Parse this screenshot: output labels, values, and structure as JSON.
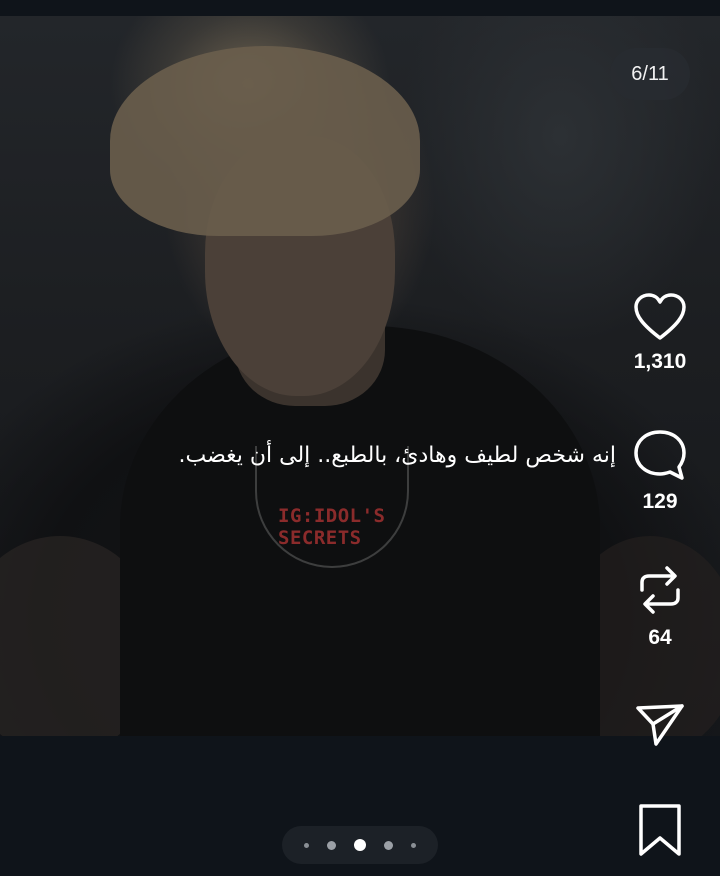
{
  "post": {
    "caption": "إنه شخص لطيف وهادئ، بالطبع.. إلى أن يغضب.",
    "watermark": "IG:IDOL'S SECRETS",
    "slide_counter": "6/11"
  },
  "actions": {
    "like_count": "1,310",
    "comment_count": "129",
    "repost_count": "64"
  },
  "carousel": {
    "total_dots_visible": 5,
    "active_index": 2
  },
  "colors": {
    "background": "#0f141a",
    "watermark": "#8b2b2b",
    "icon": "#ffffff"
  },
  "icons": [
    "heart-icon",
    "comment-icon",
    "repost-icon",
    "share-icon",
    "bookmark-icon"
  ]
}
